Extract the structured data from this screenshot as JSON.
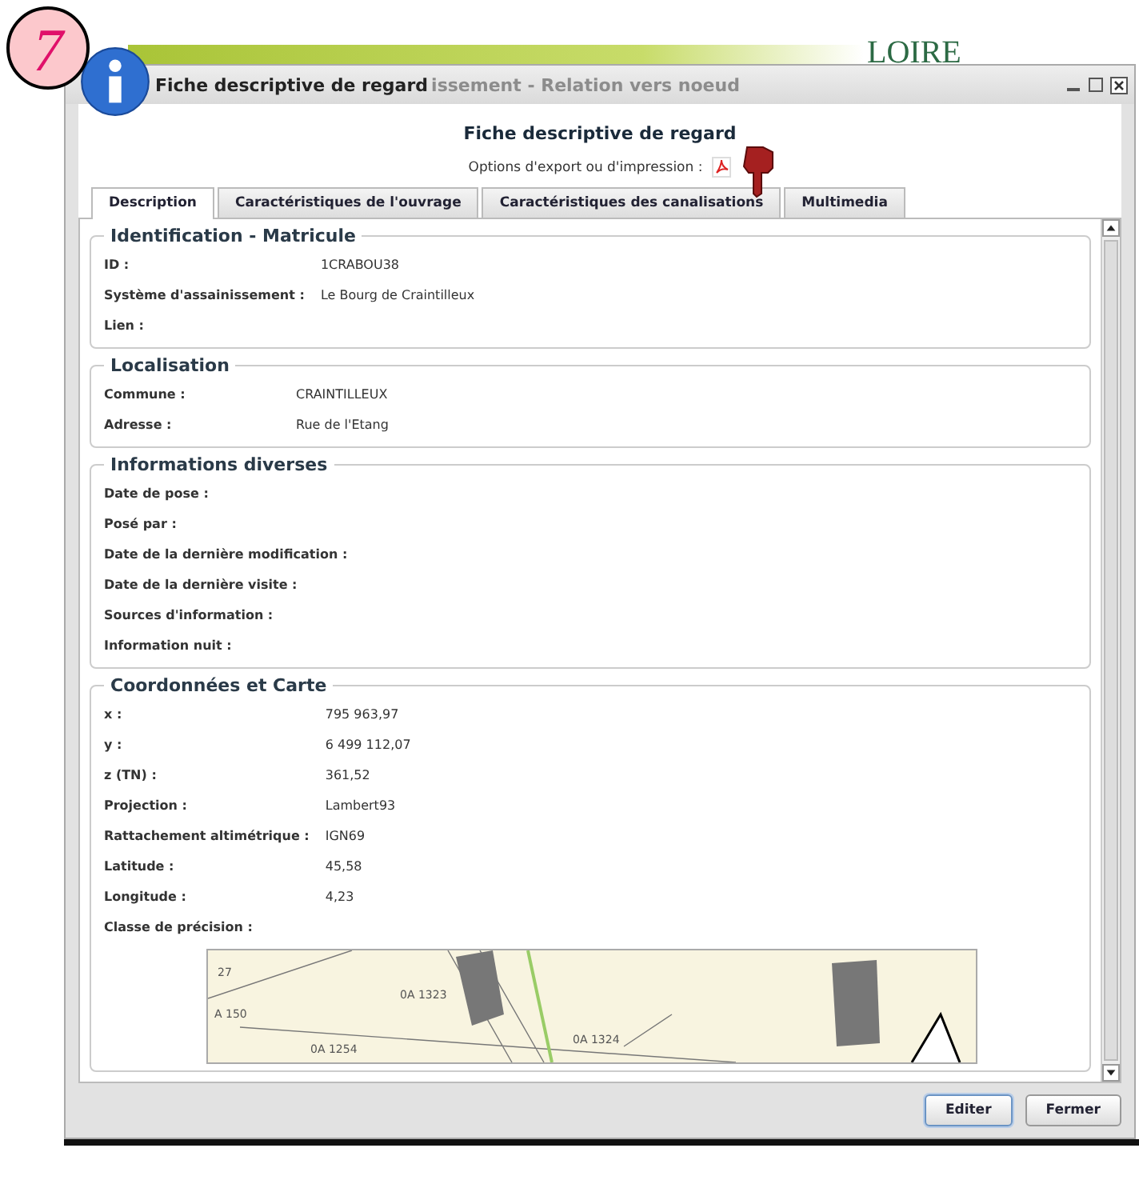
{
  "badge": "7",
  "background": {
    "logo_text": "LOIRE"
  },
  "dialog": {
    "title": "Fiche descriptive de regard",
    "background_title": "issement - Relation vers noeud",
    "heading": "Fiche descriptive de regard",
    "export_label": "Options d'export ou d'impression :"
  },
  "tabs": [
    {
      "label": "Description",
      "selected": true
    },
    {
      "label": "Caractéristiques de l'ouvrage",
      "selected": false
    },
    {
      "label": "Caractéristiques des canalisations",
      "selected": false
    },
    {
      "label": "Multimedia",
      "selected": false
    }
  ],
  "sections": [
    {
      "title": "Identification - Matricule",
      "fields": [
        {
          "label": "ID :",
          "value": "1CRABOU38"
        },
        {
          "label": "Système d'assainissement :",
          "value": "Le Bourg de Craintilleux"
        },
        {
          "label": "Lien :"
        }
      ]
    },
    {
      "title": "Localisation",
      "fields": [
        {
          "label": "Commune :",
          "value": "CRAINTILLEUX"
        },
        {
          "label": "Adresse :",
          "value": "Rue de l'Etang"
        }
      ]
    },
    {
      "title": "Informations diverses",
      "fields": [
        {
          "label": "Date de pose :"
        },
        {
          "label": "Posé par :"
        },
        {
          "label": "Date de la dernière modification :"
        },
        {
          "label": "Date de la dernière visite :"
        },
        {
          "label": "Sources d'information :"
        },
        {
          "label": "Information nuit :"
        }
      ]
    },
    {
      "title": "Coordonnées et Carte",
      "fields": [
        {
          "label": "x :",
          "value": "795 963,97"
        },
        {
          "label": "y :",
          "value": "6 499 112,07"
        },
        {
          "label": "z (TN) :",
          "value": "361,52"
        },
        {
          "label": "Projection :",
          "value": "Lambert93"
        },
        {
          "label": "Rattachement altimétrique :",
          "value": "IGN69"
        },
        {
          "label": "Latitude :",
          "value": "45,58"
        },
        {
          "label": "Longitude :",
          "value": "4,23"
        },
        {
          "label": "Classe de précision :"
        }
      ],
      "map": {
        "labels": [
          "27",
          "0A 1323",
          "A 150",
          "0A 1254",
          "0A 1324"
        ]
      }
    }
  ],
  "buttons": [
    {
      "label": "Editer",
      "focused": true
    },
    {
      "label": "Fermer",
      "focused": false
    }
  ]
}
